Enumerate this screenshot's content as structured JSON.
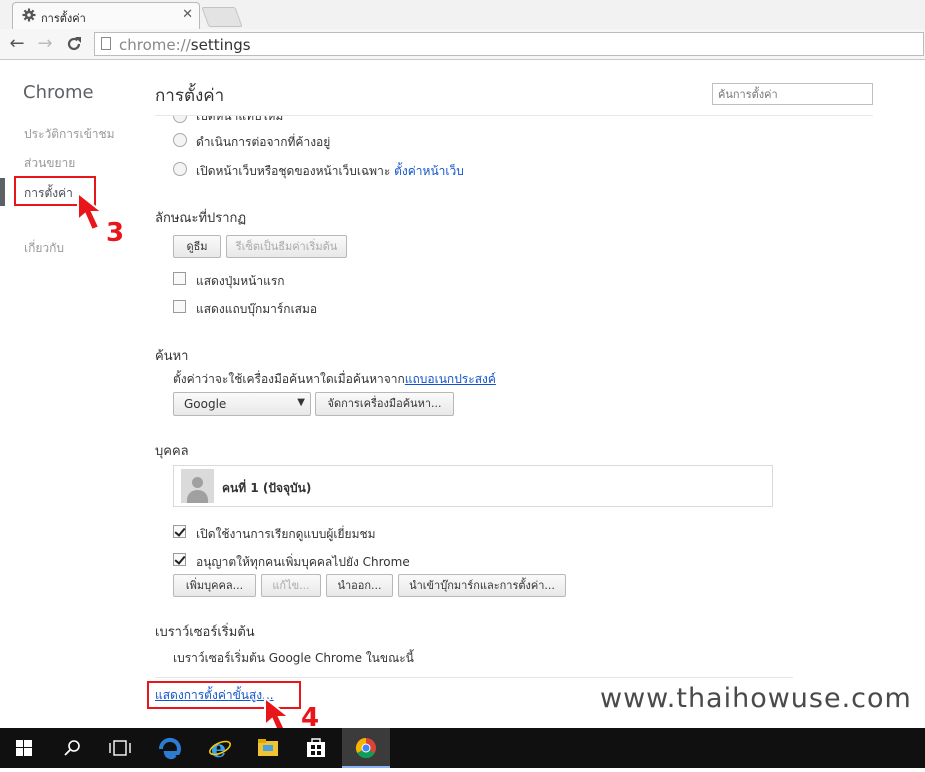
{
  "tab": {
    "title": "การตั้งค่า",
    "close": "✕"
  },
  "toolbar": {
    "back": "←",
    "forward": "→",
    "reload": "C",
    "url_scheme": "chrome://",
    "url_path": "settings"
  },
  "sidebar": {
    "brand": "Chrome",
    "items": [
      {
        "label": "ประวัติการเข้าชม"
      },
      {
        "label": "ส่วนขยาย"
      },
      {
        "label": "การตั้งค่า"
      },
      {
        "label": "เกี่ยวกับ"
      }
    ]
  },
  "header": {
    "title": "การตั้งค่า",
    "search_placeholder": "ค้นการตั้งค่า"
  },
  "startup": {
    "option_cut": "เปิดหน้าแท็บใหม่",
    "option_continue": "ดำเนินการต่อจากที่ค้างอยู่",
    "option_specific": "เปิดหน้าเว็บหรือชุดของหน้าเว็บเฉพาะ",
    "option_specific_link": "ตั้งค่าหน้าเว็บ"
  },
  "appearance": {
    "heading": "ลักษณะที่ปรากฏ",
    "themes_button": "ดูธีม",
    "reset_button": "รีเซ็ตเป็นธีมค่าเริ่มต้น",
    "show_home": "แสดงปุ่มหน้าแรก",
    "show_bookmarks": "แสดงแถบบุ๊กมาร์กเสมอ"
  },
  "search": {
    "heading": "ค้นหา",
    "description": "ตั้งค่าว่าจะใช้เครื่องมือค้นหาใดเมื่อค้นหาจาก",
    "description_link": "แถบอเนกประสงค์",
    "engine_selected": "Google",
    "manage_button": "จัดการเครื่องมือค้นหา..."
  },
  "people": {
    "heading": "บุคคล",
    "profile_name": "คนที่ 1 (ปัจจุบัน)",
    "guest_browsing": "เปิดใช้งานการเรียกดูแบบผู้เยี่ยมชม",
    "guest_browsing_checked": true,
    "add_anyone": "อนุญาตให้ทุกคนเพิ่มบุคคลไปยัง Chrome",
    "add_anyone_checked": true,
    "add_button": "เพิ่มบุคคล...",
    "edit_button": "แก้ไข...",
    "remove_button": "นำออก...",
    "import_button": "นำเข้าบุ๊กมาร์กและการตั้งค่า..."
  },
  "default_browser": {
    "heading": "เบราว์เซอร์เริ่มต้น",
    "status": "เบราว์เซอร์เริ่มต้น Google Chrome ในขณะนี้"
  },
  "advanced_link": "แสดงการตั้งค่าขั้นสูง...",
  "annotations": {
    "step3": "3",
    "step4": "4",
    "highlight_color": "#e8161b"
  },
  "watermark": "www.thaihowuse.com",
  "taskbar": {
    "icons": [
      "windows-start-icon",
      "search-icon",
      "task-view-icon",
      "edge-icon",
      "internet-explorer-icon",
      "file-explorer-icon",
      "store-icon",
      "chrome-icon"
    ]
  }
}
